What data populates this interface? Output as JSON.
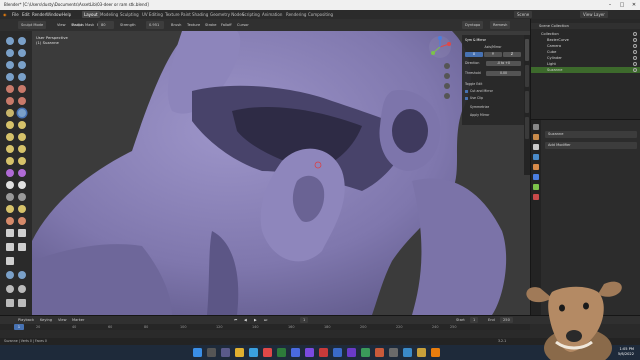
{
  "window": {
    "title": "Blender* [C:\\Users\\dusty\\Documents\\AssetLib\\03-deer or ram stk.blend]",
    "minimize": "–",
    "maximize": "□",
    "close": "✕"
  },
  "menubar": {
    "menus": [
      "File",
      "Edit",
      "Render",
      "Window",
      "Help"
    ],
    "tabs": [
      "Layout",
      "Modeling",
      "Sculpting",
      "UV Editing",
      "Texture Paint",
      "Shading",
      "Geometry Nodes",
      "Scripting",
      "Animation",
      "Rendering",
      "Compositing"
    ],
    "active_tab": "Layout",
    "scene": "Scene",
    "view_layer": "View Layer"
  },
  "header": {
    "mode": "Sculpt Mode",
    "view": "View",
    "sculpt": "Sculpt",
    "mask": "Mask",
    "face_sets": "Face Sets",
    "radius_label": "Radius",
    "radius_value": "80 px",
    "strength_label": "Strength",
    "strength_value": "0.951",
    "brush": "Brush",
    "texture": "Texture",
    "stroke": "Stroke",
    "falloff": "Falloff",
    "cursor": "Cursor",
    "dyntopo": "Dyntopo",
    "remesh": "Remesh"
  },
  "viewport": {
    "view_name": "User Perspective",
    "object_name": "(1) Suzanne"
  },
  "symmetry_panel": {
    "title": "Sym & Mirror",
    "axis_title": "Axis/Mirror",
    "axes": [
      "X",
      "Y",
      "Z"
    ],
    "direction_label": "Direction",
    "direction_value": "-X to +X",
    "threshold_label": "Threshold",
    "threshold_value": "0.00",
    "toggle_title": "Toggle Edit",
    "cut_mirror": "Cut and Mirror",
    "use_clip": "Use Clip",
    "symmetrize": "Symmetrize",
    "apply_mirror": "Apply Mirror"
  },
  "outliner": {
    "title": "Scene Collection",
    "items": [
      {
        "label": "Collection",
        "indent": 1
      },
      {
        "label": "BezierCurve",
        "indent": 2
      },
      {
        "label": "Camera",
        "indent": 2
      },
      {
        "label": "Cube",
        "indent": 2
      },
      {
        "label": "Cylinder",
        "indent": 2
      },
      {
        "label": "Light",
        "indent": 2
      },
      {
        "label": "Suzanne",
        "indent": 2
      }
    ],
    "selected": "Suzanne"
  },
  "properties": {
    "object_name": "Suzanne",
    "add_modifier": "Add Modifier"
  },
  "timeline": {
    "playback": "Playback",
    "keying": "Keying",
    "view": "View",
    "marker": "Marker",
    "current_frame": "1",
    "start_label": "Start",
    "start_value": "1",
    "end_label": "End",
    "end_value": "250",
    "ruler": [
      "1",
      "20",
      "40",
      "60",
      "80",
      "100",
      "120",
      "140",
      "160",
      "180",
      "200",
      "220",
      "240",
      "250"
    ]
  },
  "statusbar": {
    "left": "Suzanne | Verts 0 | Faces 0",
    "right": "3.2.1"
  },
  "taskbar": {
    "time": "1:05 PM",
    "date": "5/6/2022"
  },
  "colors": {
    "mesh": "#8a82b6",
    "accent": "#4772b3",
    "outliner_selected": "#3d6a2c"
  }
}
